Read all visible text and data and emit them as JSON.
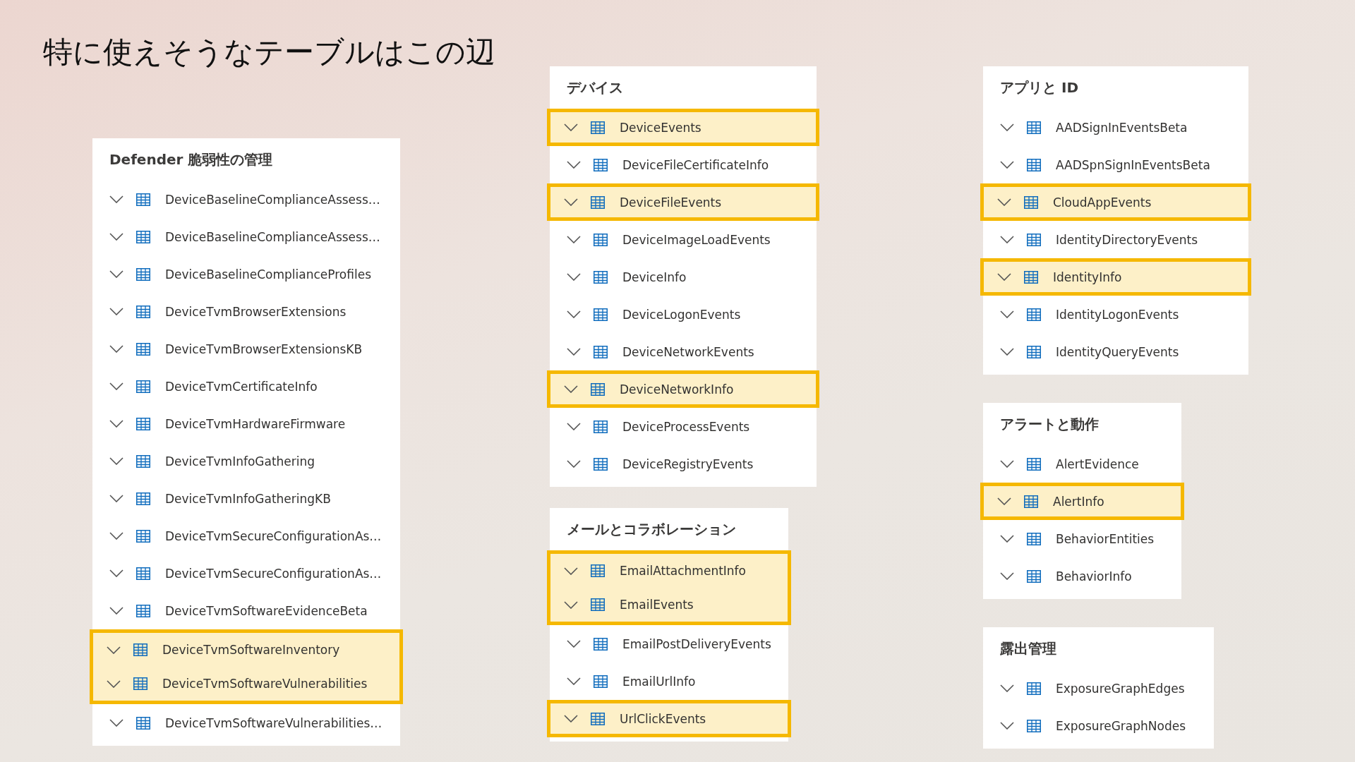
{
  "title": "特に使えそうなテーブルはこの辺",
  "columns": [
    {
      "panels": [
        {
          "title": "Defender 脆弱性の管理",
          "items": [
            {
              "name": "DeviceBaselineComplianceAssess…",
              "highlighted": false
            },
            {
              "name": "DeviceBaselineComplianceAssess…",
              "highlighted": false
            },
            {
              "name": "DeviceBaselineComplianceProfiles",
              "highlighted": false
            },
            {
              "name": "DeviceTvmBrowserExtensions",
              "highlighted": false
            },
            {
              "name": "DeviceTvmBrowserExtensionsKB",
              "highlighted": false
            },
            {
              "name": "DeviceTvmCertificateInfo",
              "highlighted": false
            },
            {
              "name": "DeviceTvmHardwareFirmware",
              "highlighted": false
            },
            {
              "name": "DeviceTvmInfoGathering",
              "highlighted": false
            },
            {
              "name": "DeviceTvmInfoGatheringKB",
              "highlighted": false
            },
            {
              "name": "DeviceTvmSecureConfigurationAs…",
              "highlighted": false
            },
            {
              "name": "DeviceTvmSecureConfigurationAs…",
              "highlighted": false
            },
            {
              "name": "DeviceTvmSoftwareEvidenceBeta",
              "highlighted": false
            },
            {
              "name": "DeviceTvmSoftwareInventory",
              "highlighted": true
            },
            {
              "name": "DeviceTvmSoftwareVulnerabilities",
              "highlighted": true
            },
            {
              "name": "DeviceTvmSoftwareVulnerabilities…",
              "highlighted": false
            }
          ]
        }
      ]
    },
    {
      "panels": [
        {
          "title": "デバイス",
          "items": [
            {
              "name": "DeviceEvents",
              "highlighted": true
            },
            {
              "name": "DeviceFileCertificateInfo",
              "highlighted": false
            },
            {
              "name": "DeviceFileEvents",
              "highlighted": true
            },
            {
              "name": "DeviceImageLoadEvents",
              "highlighted": false
            },
            {
              "name": "DeviceInfo",
              "highlighted": false
            },
            {
              "name": "DeviceLogonEvents",
              "highlighted": false
            },
            {
              "name": "DeviceNetworkEvents",
              "highlighted": false
            },
            {
              "name": "DeviceNetworkInfo",
              "highlighted": true
            },
            {
              "name": "DeviceProcessEvents",
              "highlighted": false
            },
            {
              "name": "DeviceRegistryEvents",
              "highlighted": false
            }
          ]
        },
        {
          "title": "メールとコラボレーション",
          "items": [
            {
              "name": "EmailAttachmentInfo",
              "highlighted": true
            },
            {
              "name": "EmailEvents",
              "highlighted": true
            },
            {
              "name": "EmailPostDeliveryEvents",
              "highlighted": false
            },
            {
              "name": "EmailUrlInfo",
              "highlighted": false
            },
            {
              "name": "UrlClickEvents",
              "highlighted": true
            }
          ]
        }
      ]
    },
    {
      "panels": [
        {
          "title": "アプリと ID",
          "items": [
            {
              "name": "AADSignInEventsBeta",
              "highlighted": false
            },
            {
              "name": "AADSpnSignInEventsBeta",
              "highlighted": false
            },
            {
              "name": "CloudAppEvents",
              "highlighted": true
            },
            {
              "name": "IdentityDirectoryEvents",
              "highlighted": false
            },
            {
              "name": "IdentityInfo",
              "highlighted": true
            },
            {
              "name": "IdentityLogonEvents",
              "highlighted": false
            },
            {
              "name": "IdentityQueryEvents",
              "highlighted": false
            }
          ]
        },
        {
          "title": "アラートと動作",
          "items": [
            {
              "name": "AlertEvidence",
              "highlighted": false
            },
            {
              "name": "AlertInfo",
              "highlighted": true
            },
            {
              "name": "BehaviorEntities",
              "highlighted": false
            },
            {
              "name": "BehaviorInfo",
              "highlighted": false
            }
          ]
        },
        {
          "title": "露出管理",
          "items": [
            {
              "name": "ExposureGraphEdges",
              "highlighted": false
            },
            {
              "name": "ExposureGraphNodes",
              "highlighted": false
            }
          ]
        }
      ]
    }
  ]
}
